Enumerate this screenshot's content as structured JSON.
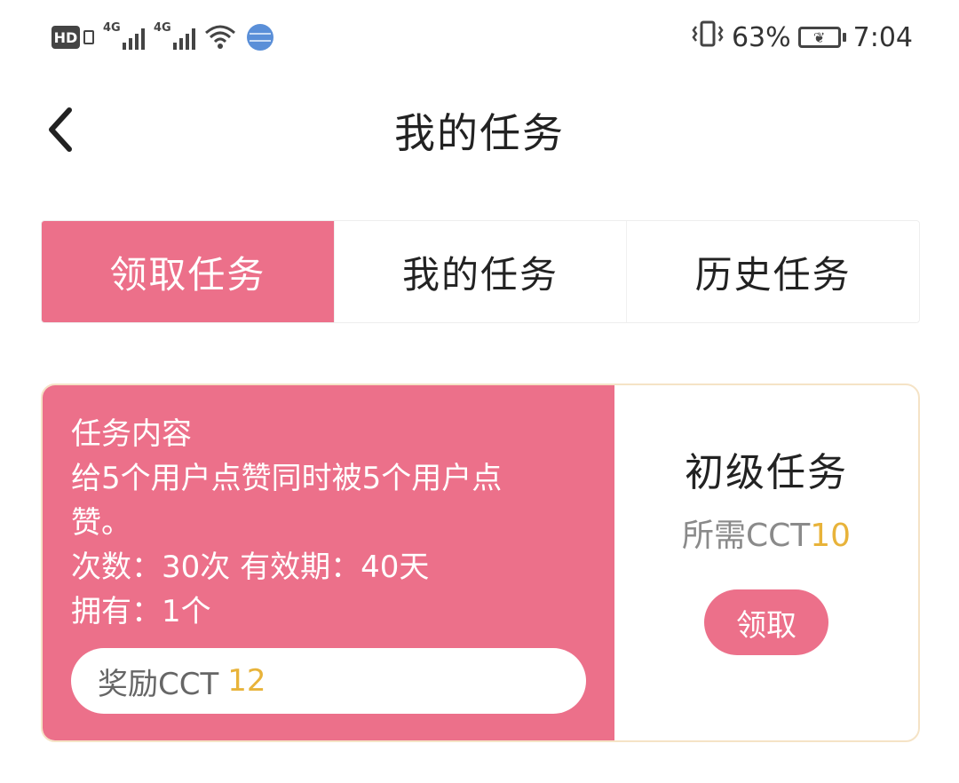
{
  "status_bar": {
    "hd_label": "HD",
    "signal1_label": "4G",
    "signal2_label": "4G",
    "battery_percent": "63%",
    "time": "7:04",
    "icons": [
      "hd-icon",
      "signal-icon",
      "signal-icon",
      "wifi-icon",
      "globe-icon",
      "vibrate-icon",
      "battery-icon"
    ]
  },
  "header": {
    "title": "我的任务",
    "back_icon": "chevron-left-icon"
  },
  "tabs": [
    {
      "label": "领取任务",
      "active": true
    },
    {
      "label": "我的任务",
      "active": false
    },
    {
      "label": "历史任务",
      "active": false
    }
  ],
  "task_card": {
    "content_label": "任务内容",
    "description_line1": "给5个用户点赞同时被5个用户点",
    "description_line2": "赞。",
    "count_label": "次数：",
    "count_value": "30次",
    "validity_label": "有效期：",
    "validity_value": "40天",
    "owned_label": "拥有：",
    "owned_value": "1个",
    "reward_label": "奖励CCT",
    "reward_value": "12",
    "level": "初级任务",
    "required_label": "所需CCT",
    "required_value": "10",
    "claim_label": "领取"
  },
  "colors": {
    "accent": "#ec708a",
    "highlight_number": "#e8b33a",
    "card_border": "#f5e3c6"
  }
}
